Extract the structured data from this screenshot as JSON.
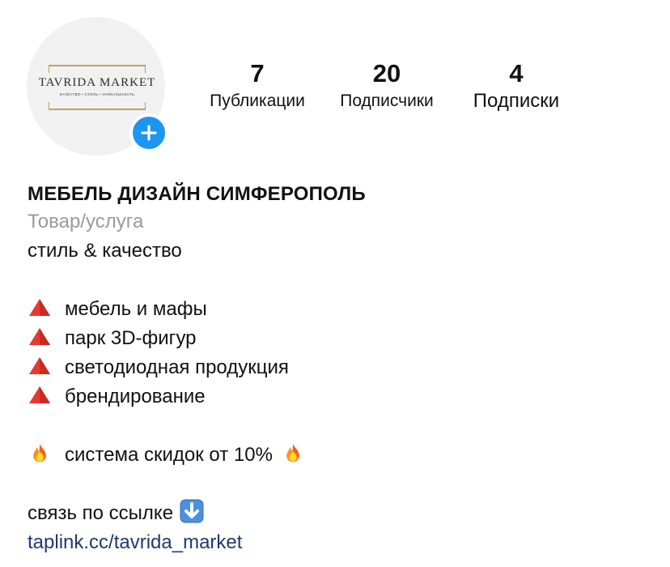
{
  "profile": {
    "logo": {
      "title": "TAVRIDA MARKET",
      "subtitle": "КАЧЕСТВО • СТИЛЬ • УНИКАЛЬНОСТЬ"
    },
    "add_story_icon": "plus-icon",
    "accent_color": "#1c96f0"
  },
  "stats": {
    "posts": {
      "value": "7",
      "label": "Публикации"
    },
    "followers": {
      "value": "20",
      "label": "Подписчики"
    },
    "following": {
      "value": "4",
      "label": "Подписки"
    }
  },
  "bio": {
    "name": "МЕБЕЛЬ ДИЗАЙН СИМФЕРОПОЛЬ",
    "category": "Товар/услуга",
    "tagline": "стиль & качество",
    "bullet_icon": "red-triangle-icon",
    "items": [
      "мебель и мафы",
      "парк 3D-фигур",
      "светодиодная продукция",
      "брендирование"
    ],
    "discount_icon": "fire-icon",
    "discount": "система скидок от 10%",
    "contact": "связь по ссылке",
    "contact_icon": "down-arrow-icon",
    "link": "taplink.cc/tavrida_market"
  }
}
